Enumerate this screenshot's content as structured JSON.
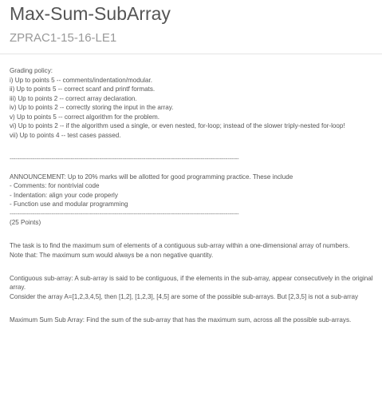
{
  "header": {
    "title": "Max-Sum-SubArray",
    "code": "ZPRAC1-15-16-LE1"
  },
  "grading": {
    "heading": "Grading policy:",
    "items": [
      "i) Up to points 5 -- comments/indentation/modular.",
      "ii) Up to points 5 -- correct scanf and printf formats.",
      "iii) Up to points 2 -- correct array declaration.",
      "iv) Up to points 2 -- correctly storing the input in the array.",
      "v) Up to points 5 -- correct algorithm for the problem.",
      "vi) Up to points 2 -- if the algorithm used a single, or even nested, for-loop; instead of the slower triply-nested for-loop!",
      "vii) Up to points 4 -- test cases passed."
    ]
  },
  "separator": "------------------------------------------------------------------------------------------------------------------------",
  "announcement": {
    "text": "ANNOUNCEMENT: Up to 20% marks will be allotted for good programming practice. These include",
    "items": [
      "- Comments: for nontrivial code",
      "- Indentation: align your code properly",
      "- Function use and modular programming"
    ]
  },
  "points": "(25 Points)",
  "task": {
    "text": "The task is to find the maximum sum of elements of a contiguous sub-array within a one-dimensional array of numbers.",
    "note": "Note that: The maximum sum would always be a non negative quantity."
  },
  "contiguous": {
    "definition": "Contiguous sub-array: A sub-array is said to be contiguous, if the elements in the sub-array, appear consecutively in the original array.",
    "example": "Consider the array A=[1,2,3,4,5], then [1,2], [1,2,3], [4,5] are some of the possible sub-arrays. But [2,3,5] is not a sub-array"
  },
  "maxsum": {
    "definition": "Maximum Sum Sub Array: Find the sum of the sub-array that has the maximum sum, across all the possible sub-arrays."
  }
}
